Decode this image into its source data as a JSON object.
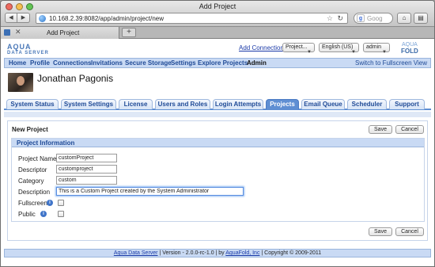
{
  "browser": {
    "window_title": "Add Project",
    "url": "10.168.2.39:8082/app/admin/project/new",
    "search_placeholder": "Goog",
    "tab_label": "Add Project",
    "back_glyph": "◀",
    "forward_glyph": "▶",
    "reload_glyph": "↻",
    "new_tab_glyph": "+",
    "tab_close_glyph": "✕",
    "home_glyph": "⌂",
    "bookmarks_glyph": "▤"
  },
  "header": {
    "logo_left_top": "AQUA",
    "logo_left_sub": "DATA SERVER",
    "logo_right_top": "AQUA",
    "logo_right_bottom": "FOLD",
    "add_connections": "Add Connections",
    "project_select": "Project...",
    "language_select": "English (US)",
    "user_select": "admin"
  },
  "nav": {
    "items": [
      "Home",
      "Profile",
      "Connections",
      "Invitations",
      "Secure Storage",
      "Settings",
      "Explore Projects",
      "Admin"
    ],
    "fullscreen": "Switch to Fullscreen View"
  },
  "user": {
    "name": "Jonathan Pagonis"
  },
  "tabs": [
    "System Status",
    "System Settings",
    "License",
    "Users and Roles",
    "Login Attempts",
    "Projects",
    "Email Queue",
    "Scheduler",
    "Support"
  ],
  "form": {
    "title": "New Project",
    "save": "Save",
    "cancel": "Cancel",
    "section": "Project Information",
    "fields": {
      "project_name": {
        "label": "Project Name",
        "value": "customProject"
      },
      "descriptor": {
        "label": "Descriptor",
        "value": "customproject"
      },
      "category": {
        "label": "Category",
        "value": "custom"
      },
      "description": {
        "label": "Description",
        "value": "This is a Custom Project created by the System Administrator"
      },
      "fullscreen": {
        "label": "Fullscreen",
        "checked": false
      },
      "public": {
        "label": "Public",
        "checked": false
      }
    }
  },
  "footer": {
    "server_link": "Aqua Data Server",
    "version": " | Version - 2.0.0-rc-1.0 | by ",
    "company_link": "AquaFold, Inc",
    "copyright": " | Copyright © 2009-2011"
  }
}
